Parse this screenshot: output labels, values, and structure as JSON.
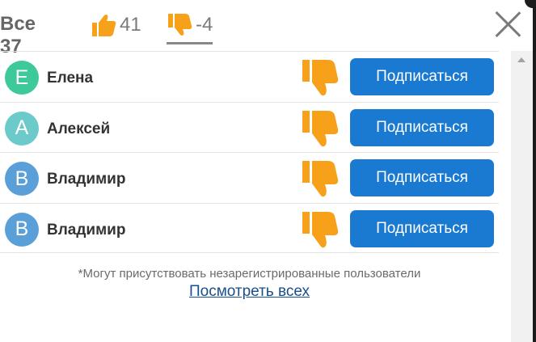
{
  "tabs": {
    "all_label": "Все 37",
    "likes_count": "41",
    "dislikes_count": "-4",
    "active": "dislikes"
  },
  "colors": {
    "accent_blue": "#1a7ad1",
    "thumb_orange": "#f7a11a"
  },
  "users": [
    {
      "initial": "E",
      "name": "Елена",
      "avatar_color": "#3ec99a",
      "reaction_icon": "thumbs-down-icon",
      "button_label": "Подписаться"
    },
    {
      "initial": "A",
      "name": "Алексей",
      "avatar_color": "#6ccaca",
      "reaction_icon": "thumbs-down-icon",
      "button_label": "Подписаться"
    },
    {
      "initial": "B",
      "name": "Владимир",
      "avatar_color": "#5a9fd8",
      "reaction_icon": "thumbs-down-icon",
      "button_label": "Подписаться"
    },
    {
      "initial": "B",
      "name": "Владимир",
      "avatar_color": "#5a9fd8",
      "reaction_icon": "thumbs-down-icon",
      "button_label": "Подписаться"
    }
  ],
  "footer": {
    "note": "*Могут присутствовать незарегистрированные пользователи",
    "view_all": "Посмотреть всех"
  }
}
